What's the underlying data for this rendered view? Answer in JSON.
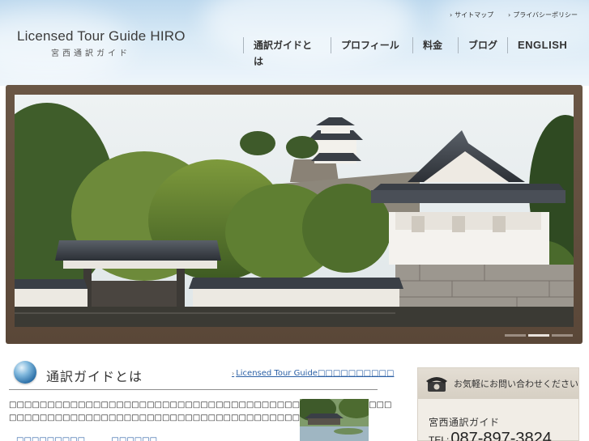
{
  "site": {
    "title": "Licensed Tour Guide HIRO",
    "subtitle": "宮西通訳ガイド"
  },
  "util_nav": [
    {
      "label": "サイトマップ"
    },
    {
      "label": "プライバシーポリシー"
    }
  ],
  "global_nav": [
    {
      "label": "通訳ガイドとは"
    },
    {
      "label": "プロフィール"
    },
    {
      "label": "料金"
    },
    {
      "label": "ブログ"
    },
    {
      "label": "ENGLISH"
    }
  ],
  "slider": {
    "slide_count": 3,
    "active_index": 1
  },
  "section": {
    "title": "通訳ガイドとは",
    "link_label": "Licensed Tour Guide□□□□□□□□□□",
    "body_line1": "□□□□□□□□□□□□□□□□□□□□□□□□□□□□□□□□□□□□□□□□□□□□□□□□□□",
    "body_line2": "□□□□□□□□□□□□□□□□□□□□□□□□□□□□□□□□□□□□□□□□□□□□□□",
    "more_link1": "□□□□□□□□□",
    "more_link2": "□□□□□□"
  },
  "contact": {
    "heading": "お気軽にお問い合わせください",
    "org_name": "宮西通訳ガイド",
    "tel_prefix": "TEL:",
    "tel_number": "087-897-3824"
  },
  "colors": {
    "link": "#2a5fa5",
    "frame": "#5e4b3c",
    "header_sky": "#c9e0f2"
  }
}
